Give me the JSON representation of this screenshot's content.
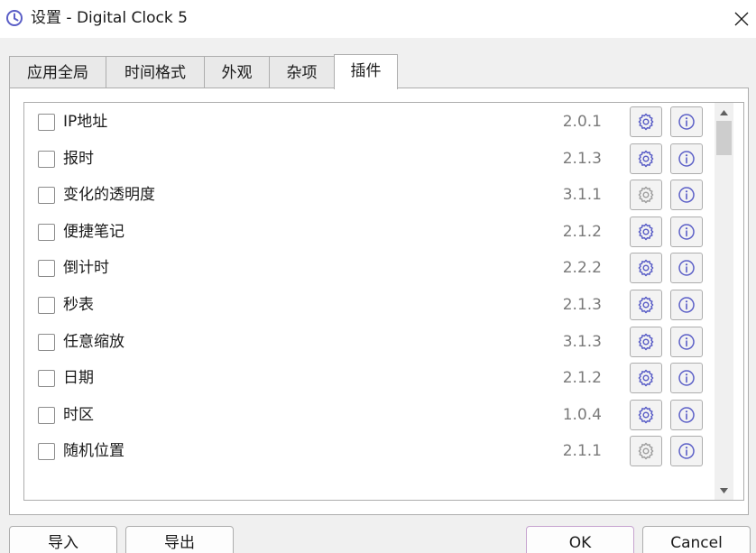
{
  "window": {
    "title": "设置 - Digital Clock 5",
    "icon": "clock-icon"
  },
  "tabs": [
    {
      "label": "应用全局",
      "active": false
    },
    {
      "label": "时间格式",
      "active": false
    },
    {
      "label": "外观",
      "active": false
    },
    {
      "label": "杂项",
      "active": false
    },
    {
      "label": "插件",
      "active": true
    }
  ],
  "plugins": [
    {
      "name": "IP地址",
      "version": "2.0.1",
      "checked": false,
      "settings_enabled": true
    },
    {
      "name": "报时",
      "version": "2.1.3",
      "checked": false,
      "settings_enabled": true
    },
    {
      "name": "变化的透明度",
      "version": "3.1.1",
      "checked": false,
      "settings_enabled": false
    },
    {
      "name": "便捷笔记",
      "version": "2.1.2",
      "checked": false,
      "settings_enabled": true
    },
    {
      "name": "倒计时",
      "version": "2.2.2",
      "checked": false,
      "settings_enabled": true
    },
    {
      "name": "秒表",
      "version": "2.1.3",
      "checked": false,
      "settings_enabled": true
    },
    {
      "name": "任意缩放",
      "version": "3.1.3",
      "checked": false,
      "settings_enabled": true
    },
    {
      "name": "日期",
      "version": "2.1.2",
      "checked": false,
      "settings_enabled": true
    },
    {
      "name": "时区",
      "version": "1.0.4",
      "checked": false,
      "settings_enabled": true
    },
    {
      "name": "随机位置",
      "version": "2.1.1",
      "checked": false,
      "settings_enabled": false
    }
  ],
  "buttons": {
    "import": "导入",
    "export": "导出",
    "ok": "OK",
    "cancel": "Cancel"
  },
  "colors": {
    "accent": "#5b5fc7",
    "disabled": "#a0a0a0",
    "version_text": "#7a7a7a",
    "ok_border": "#c6a3cf"
  }
}
